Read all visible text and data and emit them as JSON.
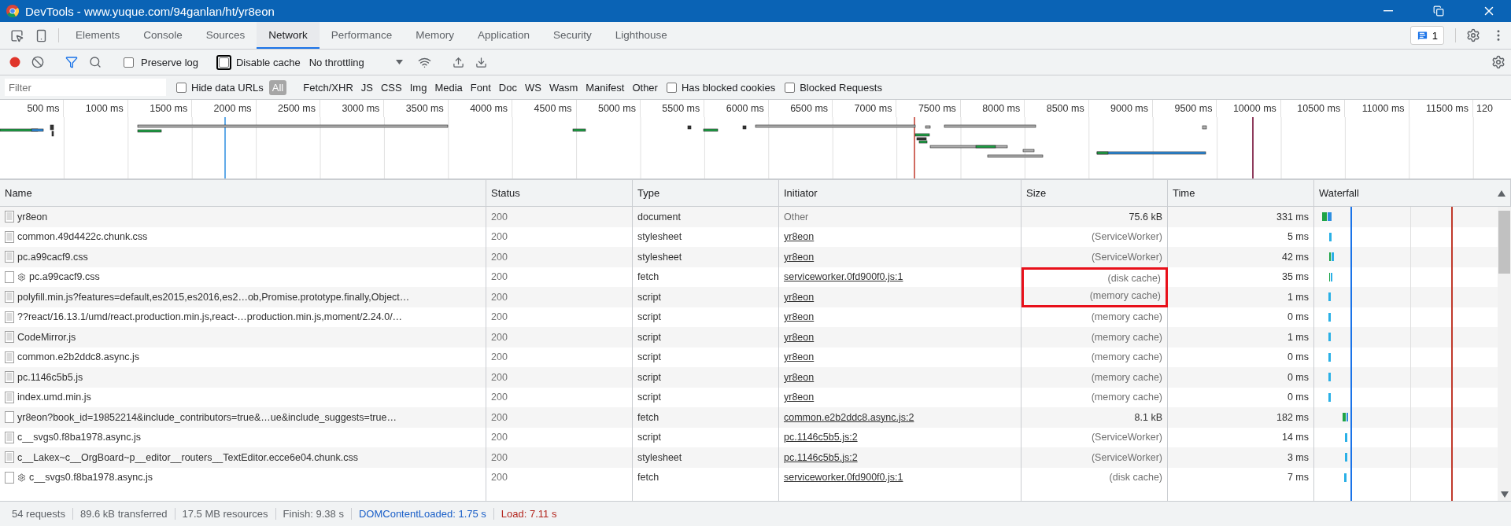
{
  "window": {
    "title": "DevTools - www.yuque.com/94ganlan/ht/yr8eon"
  },
  "tabs": [
    {
      "label": "Elements",
      "selected": false
    },
    {
      "label": "Console",
      "selected": false
    },
    {
      "label": "Sources",
      "selected": false
    },
    {
      "label": "Network",
      "selected": true
    },
    {
      "label": "Performance",
      "selected": false
    },
    {
      "label": "Memory",
      "selected": false
    },
    {
      "label": "Application",
      "selected": false
    },
    {
      "label": "Security",
      "selected": false
    },
    {
      "label": "Lighthouse",
      "selected": false
    }
  ],
  "issues_badge": "1",
  "toolbar": {
    "recording": true,
    "filter_active": true,
    "checkboxes": [
      {
        "label": "Preserve log",
        "checked": false,
        "focused": false
      },
      {
        "label": "Disable cache",
        "checked": false,
        "focused": true
      }
    ],
    "throttling": "No throttling"
  },
  "filter_bar": {
    "placeholder": "Filter",
    "hide_data_urls": {
      "label": "Hide data URLs",
      "checked": false
    },
    "types": [
      {
        "label": "All",
        "selected": true
      },
      {
        "label": "Fetch/XHR",
        "selected": false
      },
      {
        "label": "JS",
        "selected": false
      },
      {
        "label": "CSS",
        "selected": false
      },
      {
        "label": "Img",
        "selected": false
      },
      {
        "label": "Media",
        "selected": false
      },
      {
        "label": "Font",
        "selected": false
      },
      {
        "label": "Doc",
        "selected": false
      },
      {
        "label": "WS",
        "selected": false
      },
      {
        "label": "Wasm",
        "selected": false
      },
      {
        "label": "Manifest",
        "selected": false
      },
      {
        "label": "Other",
        "selected": false
      }
    ],
    "extra_checkboxes": [
      {
        "label": "Has blocked cookies",
        "checked": false
      },
      {
        "label": "Blocked Requests",
        "checked": false
      }
    ]
  },
  "overview": {
    "ticks": [
      "500 ms",
      "1000 ms",
      "1500 ms",
      "2000 ms",
      "2500 ms",
      "3000 ms",
      "3500 ms",
      "4000 ms",
      "4500 ms",
      "5000 ms",
      "5500 ms",
      "6000 ms",
      "6500 ms",
      "7000 ms",
      "7500 ms",
      "8000 ms",
      "8500 ms",
      "9000 ms",
      "9500 ms",
      "10000 ms",
      "10500 ms",
      "11000 ms",
      "11500 ms",
      "120"
    ]
  },
  "table": {
    "columns": [
      "Name",
      "Status",
      "Type",
      "Initiator",
      "Size",
      "Time",
      "Waterfall"
    ],
    "rows": [
      {
        "name": "yr8eon",
        "kind": "document",
        "service_worker": false,
        "status": "200",
        "type": "document",
        "initiator": "Other",
        "initiator_link": false,
        "size": "75.6 kB",
        "cached": false,
        "time": "331 ms",
        "boxed": false
      },
      {
        "name": "common.49d4422c.chunk.css",
        "kind": "document",
        "service_worker": false,
        "status": "200",
        "type": "stylesheet",
        "initiator": "yr8eon",
        "initiator_link": true,
        "size": "(ServiceWorker)",
        "cached": true,
        "time": "5 ms",
        "boxed": false
      },
      {
        "name": "pc.a99cacf9.css",
        "kind": "document",
        "service_worker": false,
        "status": "200",
        "type": "stylesheet",
        "initiator": "yr8eon",
        "initiator_link": true,
        "size": "(ServiceWorker)",
        "cached": true,
        "time": "42 ms",
        "boxed": false
      },
      {
        "name": "pc.a99cacf9.css",
        "kind": "blank",
        "service_worker": true,
        "status": "200",
        "type": "fetch",
        "initiator": "serviceworker.0fd900f0.js:1",
        "initiator_link": true,
        "size": "(disk cache)",
        "cached": true,
        "time": "35 ms",
        "boxed": true
      },
      {
        "name": "polyfill.min.js?features=default,es2015,es2016,es2…ob,Promise.prototype.finally,Object…",
        "kind": "document",
        "service_worker": false,
        "status": "200",
        "type": "script",
        "initiator": "yr8eon",
        "initiator_link": true,
        "size": "(memory cache)",
        "cached": true,
        "time": "1 ms",
        "boxed": true
      },
      {
        "name": "??react/16.13.1/umd/react.production.min.js,react-…production.min.js,moment/2.24.0/…",
        "kind": "document",
        "service_worker": false,
        "status": "200",
        "type": "script",
        "initiator": "yr8eon",
        "initiator_link": true,
        "size": "(memory cache)",
        "cached": true,
        "time": "0 ms",
        "boxed": false
      },
      {
        "name": "CodeMirror.js",
        "kind": "document",
        "service_worker": false,
        "status": "200",
        "type": "script",
        "initiator": "yr8eon",
        "initiator_link": true,
        "size": "(memory cache)",
        "cached": true,
        "time": "1 ms",
        "boxed": false
      },
      {
        "name": "common.e2b2ddc8.async.js",
        "kind": "document",
        "service_worker": false,
        "status": "200",
        "type": "script",
        "initiator": "yr8eon",
        "initiator_link": true,
        "size": "(memory cache)",
        "cached": true,
        "time": "0 ms",
        "boxed": false
      },
      {
        "name": "pc.1146c5b5.js",
        "kind": "document",
        "service_worker": false,
        "status": "200",
        "type": "script",
        "initiator": "yr8eon",
        "initiator_link": true,
        "size": "(memory cache)",
        "cached": true,
        "time": "0 ms",
        "boxed": false
      },
      {
        "name": "index.umd.min.js",
        "kind": "document",
        "service_worker": false,
        "status": "200",
        "type": "script",
        "initiator": "yr8eon",
        "initiator_link": true,
        "size": "(memory cache)",
        "cached": true,
        "time": "0 ms",
        "boxed": false
      },
      {
        "name": "yr8eon?book_id=19852214&include_contributors=true&…ue&include_suggests=true…",
        "kind": "blank",
        "service_worker": false,
        "status": "200",
        "type": "fetch",
        "initiator": "common.e2b2ddc8.async.js:2",
        "initiator_link": true,
        "size": "8.1 kB",
        "cached": false,
        "time": "182 ms",
        "boxed": false
      },
      {
        "name": "c__svgs0.f8ba1978.async.js",
        "kind": "document",
        "service_worker": false,
        "status": "200",
        "type": "script",
        "initiator": "pc.1146c5b5.js:2",
        "initiator_link": true,
        "size": "(ServiceWorker)",
        "cached": true,
        "time": "14 ms",
        "boxed": false
      },
      {
        "name": "c__Lakex~c__OrgBoard~p__editor__routers__TextEditor.ecce6e04.chunk.css",
        "kind": "document",
        "service_worker": false,
        "status": "200",
        "type": "stylesheet",
        "initiator": "pc.1146c5b5.js:2",
        "initiator_link": true,
        "size": "(ServiceWorker)",
        "cached": true,
        "time": "3 ms",
        "boxed": false
      },
      {
        "name": "c__svgs0.f8ba1978.async.js",
        "kind": "blank",
        "service_worker": true,
        "status": "200",
        "type": "fetch",
        "initiator": "serviceworker.0fd900f0.js:1",
        "initiator_link": true,
        "size": "(disk cache)",
        "cached": true,
        "time": "7 ms",
        "boxed": false
      }
    ]
  },
  "status_bar": [
    {
      "text": "54 requests",
      "kind": "plain"
    },
    {
      "text": "89.6 kB transferred",
      "kind": "plain"
    },
    {
      "text": "17.5 MB resources",
      "kind": "plain"
    },
    {
      "text": "Finish: 9.38 s",
      "kind": "plain"
    },
    {
      "text": "DOMContentLoaded: 1.75 s",
      "kind": "dom"
    },
    {
      "text": "Load: 7.11 s",
      "kind": "load"
    }
  ]
}
